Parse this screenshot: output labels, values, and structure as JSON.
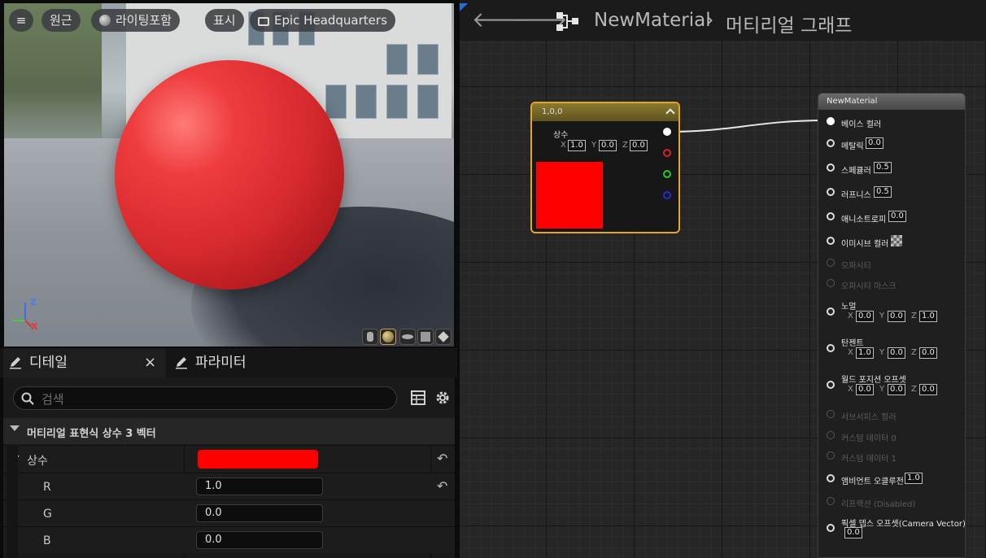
{
  "viewport": {
    "buttons": {
      "menu": "≡",
      "perspective": "원근",
      "lighting": "라이팅포함",
      "show": "표시",
      "hdr": "Epic Headquarters"
    },
    "axes": {
      "z": "Z",
      "x": "X"
    }
  },
  "details_panel": {
    "tabs": [
      {
        "label": "디테일"
      },
      {
        "label": "파라미터"
      }
    ],
    "close": "×",
    "search_placeholder": "검색",
    "category": "머티리얼 표현식 상수 3 벡터",
    "constant_label": "상수",
    "constant_color": "#ff0000",
    "rows": [
      {
        "label": "R",
        "value": "1.0"
      },
      {
        "label": "G",
        "value": "0.0"
      },
      {
        "label": "B",
        "value": "0.0"
      }
    ]
  },
  "graph": {
    "breadcrumb": {
      "asset": "NewMaterial",
      "separator": "›",
      "graph": "머티리얼 그래프"
    },
    "constant_node": {
      "title": "1,0,0",
      "label": "상수",
      "x": "1.0",
      "y": "0.0",
      "z": "0.0",
      "axis_x": "X",
      "axis_y": "Y",
      "axis_z": "Z",
      "preview_color": "#ff0000"
    },
    "material_node": {
      "title": "NewMaterial",
      "inputs": [
        {
          "label": "베이스 컬러"
        },
        {
          "label": "메탈릭",
          "value": "0.0"
        },
        {
          "label": "스페큘러",
          "value": "0.5"
        },
        {
          "label": "러프니스",
          "value": "0.5"
        },
        {
          "label": "애니소트로피",
          "value": "0.0"
        },
        {
          "label": "이미시브 컬러"
        },
        {
          "label": "오파시티"
        },
        {
          "label": "오파시티 마스크"
        },
        {
          "label": "노멀",
          "x": "0.0",
          "y": "0.0",
          "z": "1.0"
        },
        {
          "label": "탄젠트",
          "x": "1.0",
          "y": "0.0",
          "z": "0.0"
        },
        {
          "label": "월드 포지션 오프셋",
          "x": "0.0",
          "y": "0.0",
          "z": "0.0"
        },
        {
          "label": "서브서피스 컬러"
        },
        {
          "label": "커스텀 데이터 0"
        },
        {
          "label": "커스텀 데이터 1"
        },
        {
          "label": "앰비언트 오클루전",
          "value": "1.0"
        },
        {
          "label": "리프랙션 (Disabled)"
        },
        {
          "label": "픽셀 뎁스 오프셋(Camera Vector)",
          "value": "0.0"
        }
      ]
    }
  }
}
